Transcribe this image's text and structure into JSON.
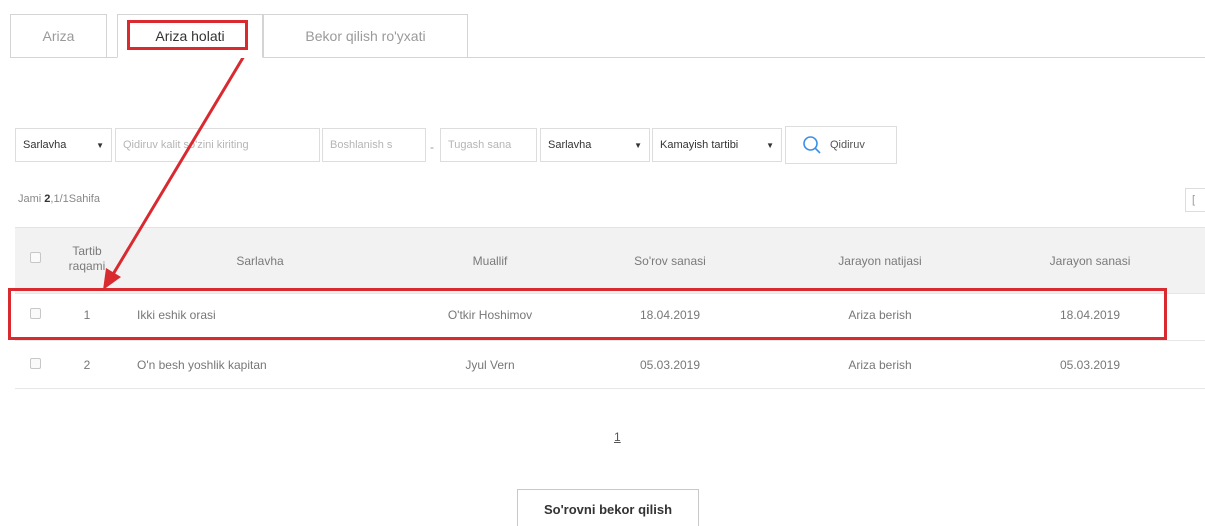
{
  "tabs": [
    {
      "label": "Ariza"
    },
    {
      "label": "Ariza holati"
    },
    {
      "label": "Bekor qilish ro'yxati"
    }
  ],
  "filters": {
    "field_select": "Sarlavha",
    "keyword_placeholder": "Qidiruv kalit so'zini kiriting",
    "start_placeholder": "Boshlanish s",
    "separator": "-",
    "end_placeholder": "Tugash sana",
    "sort_field": "Sarlavha",
    "sort_order": "Kamayish tartibi",
    "search_label": "Qidiruv"
  },
  "summary": {
    "prefix": "Jami ",
    "total": "2",
    "pages": ",1/1Sahifa"
  },
  "table": {
    "columns": [
      "Tartib raqami",
      "Sarlavha",
      "Muallif",
      "So'rov sanasi",
      "Jarayon natijasi",
      "Jarayon sanasi"
    ],
    "rows": [
      {
        "num": "1",
        "title": "Ikki eshik orasi",
        "author": "O'tkir Hoshimov",
        "request_date": "18.04.2019",
        "result": "Ariza berish",
        "process_date": "18.04.2019"
      },
      {
        "num": "2",
        "title": "O'n besh yoshlik kapitan",
        "author": "Jyul Vern",
        "request_date": "05.03.2019",
        "result": "Ariza berish",
        "process_date": "05.03.2019"
      }
    ]
  },
  "pagination": {
    "current": "1"
  },
  "actions": {
    "cancel_request": "So'rovni bekor qilish"
  },
  "colors": {
    "highlight": "#d82a2f",
    "search_icon": "#3a8ee6"
  }
}
